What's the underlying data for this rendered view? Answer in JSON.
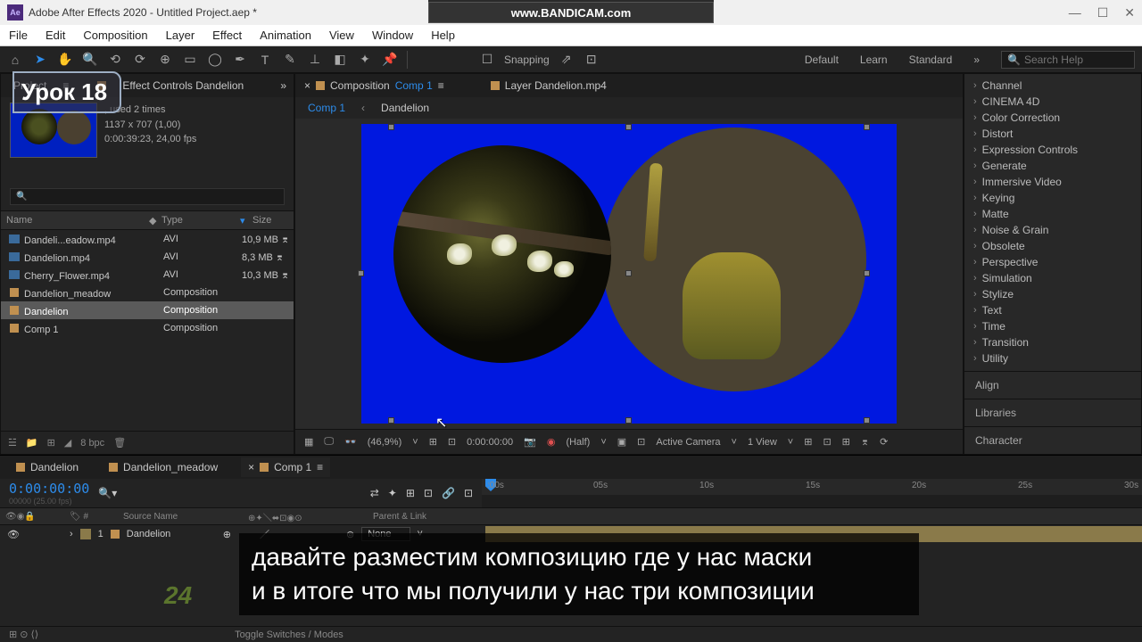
{
  "titlebar": {
    "logo": "Ae",
    "title": "Adobe After Effects 2020 - Untitled Project.aep *"
  },
  "bandicam": {
    "text": "www.BANDICAM.com"
  },
  "lesson_badge": "Урок 18",
  "menubar": [
    "File",
    "Edit",
    "Composition",
    "Layer",
    "Effect",
    "Animation",
    "View",
    "Window",
    "Help"
  ],
  "toolbar": {
    "snapping": "Snapping",
    "workspaces": [
      "Default",
      "Learn",
      "Standard"
    ],
    "search_placeholder": "Search Help"
  },
  "project_panel": {
    "tabs": {
      "project": "Project",
      "effect_controls": "Effect Controls Dandelion"
    },
    "info": {
      "used": ", used 2 times",
      "dims": "1137 x 707 (1,00)",
      "fps": "0:00:39:23, 24,00 fps"
    },
    "columns": {
      "name": "Name",
      "type": "Type",
      "size": "Size"
    },
    "rows": [
      {
        "name": "Dandeli...eadow.mp4",
        "type": "AVI",
        "size": "10,9 MB",
        "icon": "video"
      },
      {
        "name": "Dandelion.mp4",
        "type": "AVI",
        "size": "8,3 MB",
        "icon": "video"
      },
      {
        "name": "Cherry_Flower.mp4",
        "type": "AVI",
        "size": "10,3 MB",
        "icon": "video"
      },
      {
        "name": "Dandelion_meadow",
        "type": "Composition",
        "size": "",
        "icon": "comp"
      },
      {
        "name": "Dandelion",
        "type": "Composition",
        "size": "",
        "icon": "comp",
        "selected": true
      },
      {
        "name": "Comp 1",
        "type": "Composition",
        "size": "",
        "icon": "comp"
      }
    ],
    "bpc": "8 bpc"
  },
  "comp_panel": {
    "tab_label": "Composition",
    "tab_link": "Comp 1",
    "layer_tab": "Layer  Dandelion.mp4",
    "breadcrumb": [
      "Comp 1",
      "Dandelion"
    ],
    "footer": {
      "zoom": "(46,9%)",
      "time": "0:00:00:00",
      "res": "(Half)",
      "camera": "Active Camera",
      "view": "1 View"
    }
  },
  "effects": {
    "categories": [
      "Channel",
      "CINEMA 4D",
      "Color Correction",
      "Distort",
      "Expression Controls",
      "Generate",
      "Immersive Video",
      "Keying",
      "Matte",
      "Noise & Grain",
      "Obsolete",
      "Perspective",
      "Simulation",
      "Stylize",
      "Text",
      "Time",
      "Transition",
      "Utility"
    ],
    "panels": [
      "Align",
      "Libraries",
      "Character"
    ]
  },
  "timeline": {
    "tabs": [
      {
        "label": "Dandelion"
      },
      {
        "label": "Dandelion_meadow"
      },
      {
        "label": "Comp 1",
        "active": true
      }
    ],
    "timecode": "0:00:00:00",
    "subtime": "00000 (25.00 fps)",
    "ruler": [
      ":00s",
      "05s",
      "10s",
      "15s",
      "20s",
      "25s",
      "30s"
    ],
    "header": {
      "source": "Source Name",
      "parent": "Parent & Link"
    },
    "layer": {
      "num": "1",
      "name": "Dandelion",
      "parent": "None"
    },
    "toggle": "Toggle Switches / Modes"
  },
  "subtitle": {
    "line1": "давайте разместим композицию где у нас маски",
    "line2": "и в итоге что мы получили у нас три композиции"
  }
}
